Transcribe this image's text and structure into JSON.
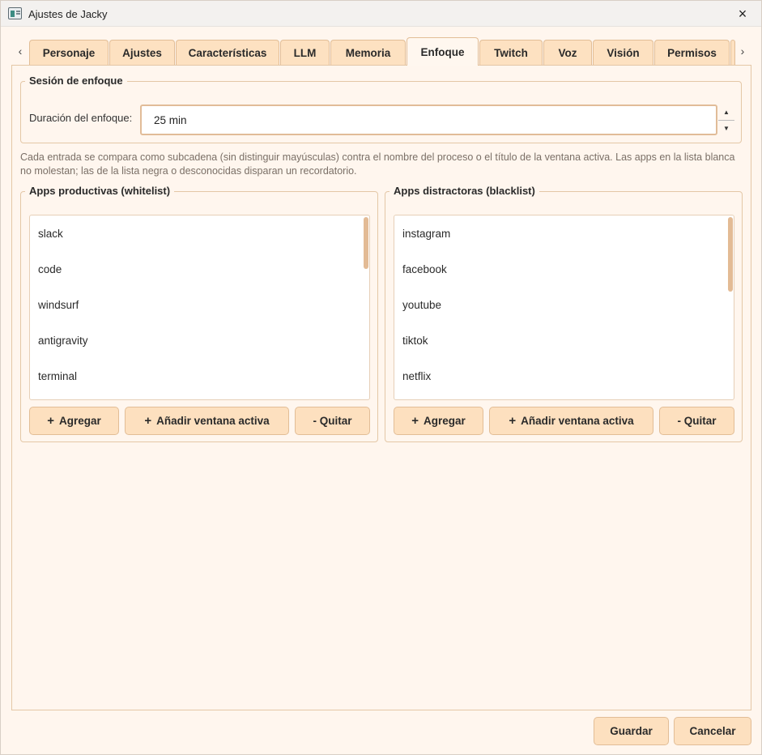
{
  "window": {
    "title": "Ajustes de Jacky",
    "close_icon": "×"
  },
  "tabs": {
    "left_arrow": "‹",
    "right_arrow": "›",
    "items": [
      {
        "label": "Personaje"
      },
      {
        "label": "Ajustes"
      },
      {
        "label": "Características"
      },
      {
        "label": "LLM"
      },
      {
        "label": "Memoria"
      },
      {
        "label": "Enfoque",
        "active": true
      },
      {
        "label": "Twitch"
      },
      {
        "label": "Voz"
      },
      {
        "label": "Visión"
      },
      {
        "label": "Permisos"
      }
    ]
  },
  "focus_session": {
    "title": "Sesión de enfoque",
    "duration_label": "Duración del enfoque:",
    "duration_value": "25 min",
    "spin_up": "▲",
    "spin_down": "▼"
  },
  "help_text": "Cada entrada se compara como subcadena (sin distinguir mayúsculas) contra el nombre del proceso o el título de la ventana activa. Las apps en la lista blanca no molestan; las de la lista negra o desconocidas disparan un recordatorio.",
  "whitelist": {
    "title": "Apps productivas (whitelist)",
    "items": [
      "slack",
      "code",
      "windsurf",
      "antigravity",
      "terminal"
    ],
    "add_label": "Agregar",
    "add_active_label": "Añadir ventana activa",
    "remove_label": "- Quitar"
  },
  "blacklist": {
    "title": "Apps distractoras (blacklist)",
    "items": [
      "instagram",
      "facebook",
      "youtube",
      "tiktok",
      "netflix"
    ],
    "add_label": "Agregar",
    "add_active_label": "Añadir ventana activa",
    "remove_label": "- Quitar"
  },
  "footer": {
    "save_label": "Guardar",
    "cancel_label": "Cancelar"
  },
  "colors": {
    "accent": "#fde0bf",
    "border": "#e2bd96",
    "background": "#fff6ee"
  }
}
